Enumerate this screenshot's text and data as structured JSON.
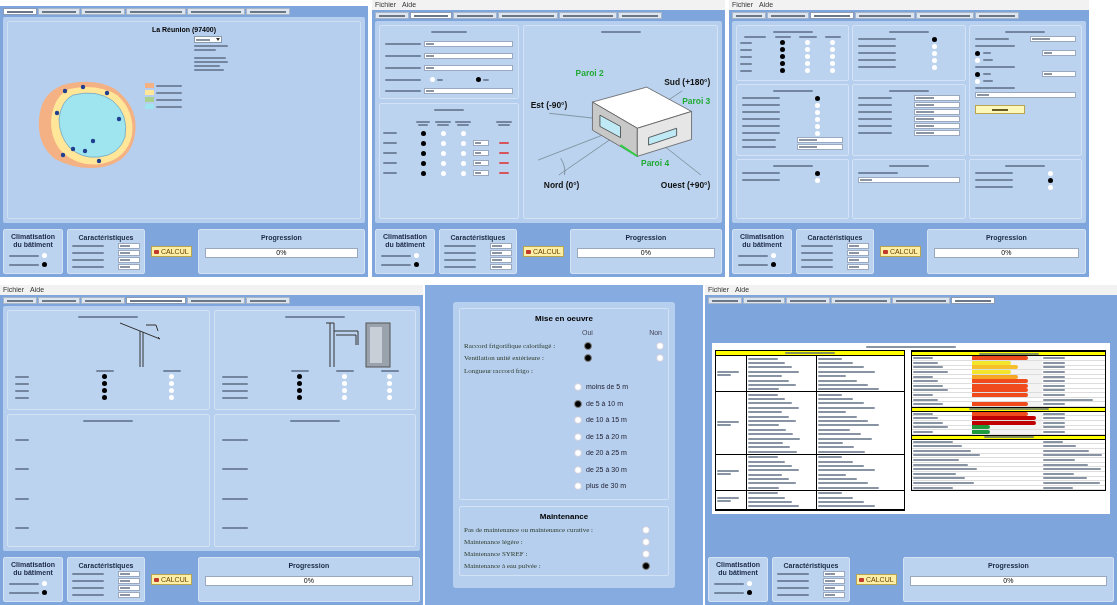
{
  "screens": [
    {
      "kind": "map",
      "tabs": [
        {
          "selected": true
        },
        {
          "selected": false
        },
        {
          "selected": false
        },
        {
          "selected": false
        },
        {
          "selected": false
        },
        {
          "selected": false
        }
      ],
      "map": {
        "title": "La Réunion (97400)",
        "legend": [
          {
            "color": "#f4b183"
          },
          {
            "color": "#ffe699"
          },
          {
            "color": "#a9d18e"
          },
          {
            "color": "#9fe5f0"
          }
        ]
      },
      "footer": {
        "climatisation_title": "Climatisation du bâtiment",
        "characteristics_title": "Caractéristiques",
        "options": [
          {
            "selected": false
          },
          {
            "selected": true
          }
        ],
        "button": "CALCUL",
        "progress": {
          "title": "Progression",
          "level": 0,
          "text": "0%"
        }
      }
    },
    {
      "kind": "geometry",
      "menu": [
        "Fichier",
        "Aide"
      ],
      "tabs": [
        {
          "selected": false
        },
        {
          "selected": true
        },
        {
          "selected": false
        },
        {
          "selected": false
        },
        {
          "selected": false
        },
        {
          "selected": false
        }
      ],
      "geometry": {
        "form": [
          {
            "kind": "field"
          },
          {
            "kind": "field"
          },
          {
            "kind": "field"
          },
          {
            "kind": "choice",
            "options": [
              {
                "selected": false
              },
              {
                "selected": true
              }
            ]
          },
          {
            "kind": "field"
          }
        ],
        "walls": [
          {
            "options": [
              {
                "selected": true
              },
              {
                "selected": false
              },
              {
                "selected": false
              }
            ]
          },
          {
            "options": [
              {
                "selected": true
              },
              {
                "selected": false
              },
              {
                "selected": false
              }
            ],
            "glazed": true
          },
          {
            "options": [
              {
                "selected": true
              },
              {
                "selected": false
              },
              {
                "selected": false
              }
            ],
            "glazed": true
          },
          {
            "options": [
              {
                "selected": true
              },
              {
                "selected": false
              },
              {
                "selected": false
              }
            ],
            "glazed": true
          },
          {
            "options": [
              {
                "selected": true
              },
              {
                "selected": false
              },
              {
                "selected": false
              }
            ],
            "glazed": true
          }
        ],
        "labels": [
          {
            "text": "Paroi 2",
            "kind": "wall"
          },
          {
            "text": "Sud (+180°)",
            "kind": "direction"
          },
          {
            "text": "Paroi 3",
            "kind": "wall"
          },
          {
            "text": "Est (-90°)",
            "kind": "direction"
          },
          {
            "text": "Paroi 4",
            "kind": "wall"
          },
          {
            "text": "Nord (0°)",
            "kind": "direction"
          },
          {
            "text": "Ouest (+90°)",
            "kind": "direction"
          }
        ]
      },
      "footer": {
        "climatisation_title": "Climatisation du bâtiment",
        "characteristics_title": "Caractéristiques",
        "options": [
          {
            "selected": false
          },
          {
            "selected": true
          }
        ],
        "button": "CALCUL",
        "progress": {
          "title": "Progression",
          "level": 0,
          "text": "0%"
        }
      }
    },
    {
      "kind": "description",
      "menu": [
        "Fichier",
        "Aide"
      ],
      "tabs": [
        {
          "selected": false
        },
        {
          "selected": false
        },
        {
          "selected": true
        },
        {
          "selected": false
        },
        {
          "selected": false
        },
        {
          "selected": false
        }
      ],
      "sections": [
        {
          "kind": "grid",
          "rows": [
            {
              "options": [
                {
                  "selected": true
                },
                {
                  "selected": false
                },
                {
                  "selected": false
                }
              ]
            },
            {
              "options": [
                {
                  "selected": true
                },
                {
                  "selected": false
                },
                {
                  "selected": false
                }
              ]
            },
            {
              "options": [
                {
                  "selected": true
                },
                {
                  "selected": false
                },
                {
                  "selected": false
                }
              ]
            },
            {
              "options": [
                {
                  "selected": true
                },
                {
                  "selected": false
                },
                {
                  "selected": false
                }
              ]
            },
            {
              "options": [
                {
                  "selected": true
                },
                {
                  "selected": false
                },
                {
                  "selected": false
                }
              ]
            }
          ]
        },
        {
          "kind": "list",
          "items": [
            {
              "kind": "radio",
              "selected": true
            },
            {
              "kind": "radio",
              "selected": false
            },
            {
              "kind": "radio",
              "selected": false
            },
            {
              "kind": "radio",
              "selected": false
            },
            {
              "kind": "radio",
              "selected": false
            }
          ]
        },
        {
          "kind": "list",
          "items": [
            {
              "kind": "select"
            },
            {
              "kind": "text"
            },
            {
              "kind": "radio-field",
              "selected": true
            },
            {
              "kind": "radio-option",
              "selected": false
            },
            {
              "kind": "text"
            },
            {
              "kind": "radio-field",
              "selected": true
            },
            {
              "kind": "radio-option",
              "selected": false
            },
            {
              "kind": "text"
            },
            {
              "kind": "wide-select"
            },
            {
              "kind": "button"
            }
          ]
        },
        {
          "kind": "list",
          "items": [
            {
              "kind": "radio",
              "selected": true
            },
            {
              "kind": "radio",
              "selected": false
            },
            {
              "kind": "radio",
              "selected": false
            },
            {
              "kind": "radio",
              "selected": false
            },
            {
              "kind": "radio",
              "selected": false
            },
            {
              "kind": "radio",
              "selected": false
            },
            {
              "kind": "select"
            },
            {
              "kind": "select"
            }
          ]
        },
        {
          "kind": "list",
          "items": [
            {
              "kind": "field"
            },
            {
              "kind": "field"
            },
            {
              "kind": "field"
            },
            {
              "kind": "field"
            },
            {
              "kind": "field"
            },
            {
              "kind": "field"
            }
          ]
        },
        {
          "kind": "list",
          "items": [
            {
              "kind": "radio",
              "selected": true
            },
            {
              "kind": "radio",
              "selected": false
            }
          ]
        },
        {
          "kind": "list",
          "items": [
            {
              "kind": "text"
            },
            {
              "kind": "wide-select"
            }
          ]
        },
        {
          "kind": "list",
          "items": [
            {
              "kind": "radio",
              "selected": false
            },
            {
              "kind": "radio",
              "selected": true
            },
            {
              "kind": "radio",
              "selected": false
            }
          ]
        }
      ],
      "footer": {
        "climatisation_title": "Climatisation du bâtiment",
        "characteristics_title": "Caractéristiques",
        "options": [
          {
            "selected": false
          },
          {
            "selected": true
          }
        ],
        "button": "CALCUL",
        "progress": {
          "title": "Progression",
          "level": 0,
          "text": "0%"
        }
      }
    },
    {
      "kind": "protections",
      "menu": [
        "Fichier",
        "Aide"
      ],
      "tabs": [
        {
          "selected": false
        },
        {
          "selected": false
        },
        {
          "selected": false
        },
        {
          "selected": true
        },
        {
          "selected": false
        },
        {
          "selected": false
        }
      ],
      "protections": [
        {
          "kind": "wall",
          "rows": [
            {
              "options": [
                {
                  "selected": true
                },
                {
                  "selected": false
                }
              ]
            },
            {
              "options": [
                {
                  "selected": true
                },
                {
                  "selected": false
                }
              ]
            },
            {
              "options": [
                {
                  "selected": true
                },
                {
                  "selected": false
                }
              ]
            },
            {
              "options": [
                {
                  "selected": true
                },
                {
                  "selected": false
                }
              ]
            }
          ]
        },
        {
          "kind": "window",
          "rows": [
            {
              "options": [
                {
                  "selected": true
                },
                {
                  "selected": false
                },
                {
                  "selected": false
                }
              ]
            },
            {
              "options": [
                {
                  "selected": true
                },
                {
                  "selected": false
                },
                {
                  "selected": false
                }
              ]
            },
            {
              "options": [
                {
                  "selected": true
                },
                {
                  "selected": false
                },
                {
                  "selected": false
                }
              ]
            },
            {
              "options": [
                {
                  "selected": true
                },
                {
                  "selected": false
                },
                {
                  "selected": false
                }
              ]
            }
          ]
        }
      ],
      "footer": {
        "climatisation_title": "Climatisation du bâtiment",
        "characteristics_title": "Caractéristiques",
        "options": [
          {
            "selected": false
          },
          {
            "selected": true
          }
        ],
        "button": "CALCUL",
        "progress": {
          "title": "Progression",
          "level": 0,
          "text": "0%"
        }
      }
    },
    {
      "kind": "implementation",
      "implementation": {
        "title": "Mise en oeuvre",
        "yes": "Oui",
        "no": "Non",
        "questions": [
          {
            "label": "Raccord frigorifique calorifugé :",
            "options": [
              {
                "selected": true
              },
              {
                "selected": false
              }
            ]
          },
          {
            "label": "Ventilation unité extérieure :",
            "options": [
              {
                "selected": true
              },
              {
                "selected": false
              }
            ]
          }
        ],
        "length_label": "Longueur raccord frigo :",
        "lengths": [
          {
            "label": "moins de 5 m",
            "selected": false
          },
          {
            "label": "de 5 à 10 m",
            "selected": true
          },
          {
            "label": "de 10 à 15 m",
            "selected": false
          },
          {
            "label": "de 15 à 20 m",
            "selected": false
          },
          {
            "label": "de 20 à 25 m",
            "selected": false
          },
          {
            "label": "de 25 à 30 m",
            "selected": false
          },
          {
            "label": "plus de 30 m",
            "selected": false
          }
        ],
        "maintenance": {
          "title": "Maintenance",
          "options": [
            {
              "label": "Pas de maintenance ou maintenance curative :",
              "selected": false
            },
            {
              "label": "Maintenance légère :",
              "selected": false
            },
            {
              "label": "Maintenance SYREF :",
              "selected": false
            },
            {
              "label": "Maintenance à eau pulvée :",
              "selected": true
            }
          ]
        }
      }
    },
    {
      "kind": "results",
      "menu": [
        "Fichier",
        "Aide"
      ],
      "tabs": [
        {
          "selected": false
        },
        {
          "selected": false
        },
        {
          "selected": false
        },
        {
          "selected": false
        },
        {
          "selected": false
        },
        {
          "selected": true
        }
      ],
      "results": {
        "envelope": [
          {
            "level": 0.8,
            "color": "#ef4b1d"
          },
          {
            "level": 0.55,
            "color": "#f3e52b"
          },
          {
            "level": 0.65,
            "color": "#f5c02a"
          },
          {
            "level": 0.55,
            "color": "#f3e52b"
          },
          {
            "level": 0.65,
            "color": "#f5a623"
          },
          {
            "level": 0.8,
            "color": "#ef4b1d"
          },
          {
            "level": 0.8,
            "color": "#ef4b1d"
          },
          {
            "level": 0.8,
            "color": "#ef4b1d"
          },
          {
            "level": 0.8,
            "color": "#ef4b1d"
          },
          {
            "kind": "plain"
          },
          {
            "level": 0.8,
            "color": "#ef4b1d"
          }
        ],
        "system": [
          {
            "level": 0.8,
            "color": "#ef4b1d"
          },
          {
            "level": 0.92,
            "color": "#c00000"
          },
          {
            "level": 0.92,
            "color": "#c00000"
          },
          {
            "level": 0.25,
            "color": "#1e9a3c"
          },
          {
            "level": 0.25,
            "color": "#1e9a3c"
          }
        ]
      },
      "footer": {
        "climatisation_title": "Climatisation du bâtiment",
        "characteristics_title": "Caractéristiques",
        "options": [
          {
            "selected": false
          },
          {
            "selected": true
          }
        ],
        "button": "CALCUL",
        "progress": {
          "title": "Progression",
          "level": 0,
          "text": "0%"
        }
      }
    }
  ]
}
